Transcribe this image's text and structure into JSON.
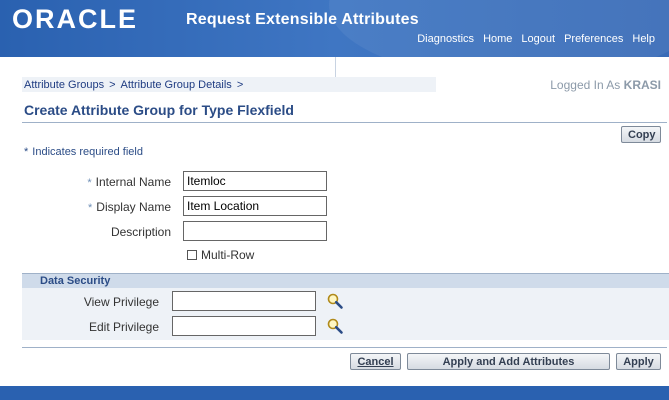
{
  "header": {
    "logo": "ORACLE",
    "app_title": "Request Extensible Attributes",
    "nav": [
      "Diagnostics",
      "Home",
      "Logout",
      "Preferences",
      "Help"
    ]
  },
  "breadcrumb": {
    "items": [
      "Attribute Groups",
      "Attribute Group Details"
    ],
    "separator": ">"
  },
  "user": {
    "prefix": "Logged In As",
    "name": "KRASI"
  },
  "page": {
    "title": "Create Attribute Group for Type Flexfield",
    "copy_label": "Copy",
    "required_note": "Indicates required field",
    "required_star": "*"
  },
  "form": {
    "internal_name": {
      "label": "Internal Name",
      "value": "Itemloc"
    },
    "display_name": {
      "label": "Display Name",
      "value": "Item Location"
    },
    "description": {
      "label": "Description",
      "value": ""
    },
    "multi_row": {
      "label": "Multi-Row",
      "checked": false
    }
  },
  "data_security": {
    "title": "Data Security",
    "view_privilege": {
      "label": "View Privilege",
      "value": ""
    },
    "edit_privilege": {
      "label": "Edit Privilege",
      "value": ""
    }
  },
  "actions": {
    "cancel": "Cancel",
    "apply_add": "Apply and Add Attributes",
    "apply": "Apply"
  },
  "colors": {
    "brand_blue": "#2a61b0",
    "link_blue": "#1f3c82",
    "section_fill": "#cfdbea"
  }
}
